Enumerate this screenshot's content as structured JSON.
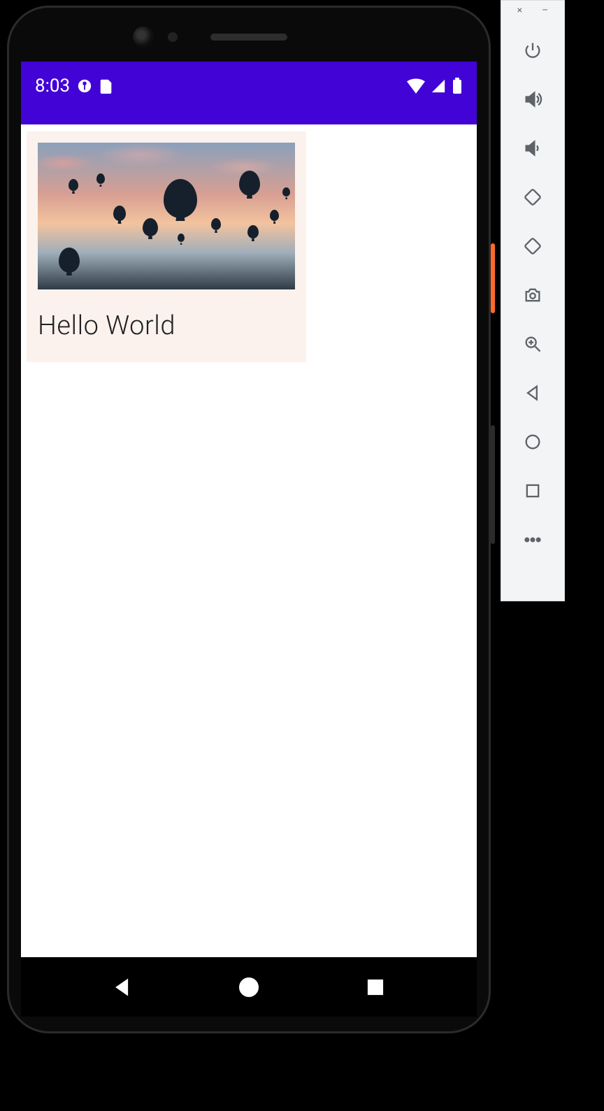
{
  "statusbar": {
    "time": "8:03",
    "icons_left": [
      "debug-icon",
      "sd-icon"
    ],
    "icons_right": [
      "wifi-icon",
      "signal-icon",
      "battery-icon"
    ]
  },
  "card": {
    "title": "Hello World",
    "image_alt": "hot air balloons at sunset"
  },
  "nav": {
    "back": "back",
    "home": "home",
    "recent": "recent"
  },
  "emulator": {
    "window": {
      "close": "×",
      "minimize": "–"
    },
    "buttons": [
      "power",
      "volume-up",
      "volume-down",
      "rotate-left",
      "rotate-right",
      "screenshot",
      "zoom",
      "back",
      "home",
      "overview",
      "more"
    ]
  }
}
